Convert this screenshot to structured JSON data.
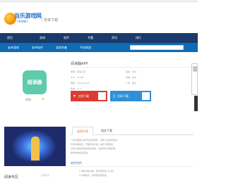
{
  "site": {
    "logo_text": "当乐游戏网",
    "logo_sub": "CRANEI",
    "tagline": "安卓下载"
  },
  "nav": {
    "items": [
      "首页",
      "游戏",
      "软件",
      "专题",
      "资讯",
      "排行"
    ]
  },
  "subnav": {
    "items": [
      "安卓游戏",
      "安卓软件",
      "游戏合集",
      "手机网游"
    ]
  },
  "app": {
    "icon_text": "阅读器",
    "rating_label": "评分",
    "title": "阅读器APP",
    "meta_left": [
      "类型：阅读工具",
      "大小：12.5M",
      "更新：2019-12-03",
      "版本：v1.0"
    ],
    "meta_right": [
      "语言：中文",
      "系统：安卓",
      "厂商：官方"
    ],
    "download_label": "立即下载",
    "qr_label": "扫码下载"
  },
  "side_tab": {
    "label": "返回顶部"
  },
  "banner": {
    "label": "阅读专区",
    "side_item": "查看更多"
  },
  "tabs": [
    "应用介绍",
    "相关下载"
  ],
  "description": {
    "lines": [
      "一款功能强大的手机阅读软件，海量小说免费阅读，",
      "支持多种格式，界面简洁清爽，操作方便快捷，",
      "为用户提供舒适的阅读体验，书架同步云端存储，",
      "随时随地想读就读。"
    ]
  },
  "section": {
    "title": "软件特色"
  },
  "bottom_description": {
    "lines": [
      "1.海量书籍资源，每日更新热门小说；",
      "2.护眼模式，夜间阅读更舒适。"
    ]
  },
  "colors": {
    "nav_bg": "#1a3a6b",
    "subnav_bg": "#0f6bb4",
    "download_red": "#dd3b32",
    "download_blue": "#2f8fd8",
    "app_icon_green": "#5fcbaa"
  }
}
